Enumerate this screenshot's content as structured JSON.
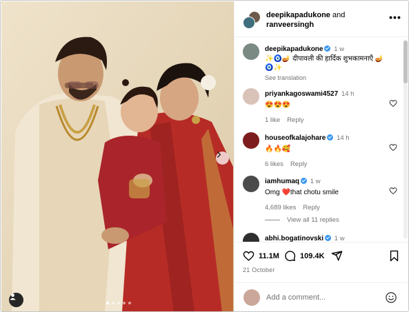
{
  "header": {
    "user1": "deepikapadukone",
    "joiner": "and",
    "user2": "ranveersingh",
    "more_label": "•••"
  },
  "caption": {
    "username": "deepikapadukone",
    "time": "1 w",
    "text": "✨🧿🪔 दीपावली की हार्दिक शुभकामनाएँ 🪔 🧿✨",
    "see_translation": "See translation"
  },
  "comments": [
    {
      "username": "priyankagoswami4527",
      "verified": false,
      "time": "14 h",
      "text": "😍😍😍",
      "likes": "1 like",
      "reply": "Reply"
    },
    {
      "username": "houseofkalajohare",
      "verified": true,
      "time": "14 h",
      "text": "🔥🔥🥰",
      "likes": "6 likes",
      "reply": "Reply"
    },
    {
      "username": "iamhumaq",
      "verified": true,
      "time": "1 w",
      "text": "Omg ❤️that chotu smile",
      "likes": "4,689 likes",
      "reply": "Reply"
    },
    {
      "username": "abhi.bogatinovski",
      "verified": true,
      "time": "1 w",
      "text": "",
      "likes": "",
      "reply": ""
    }
  ],
  "view_replies": "View all 11 replies",
  "actions": {
    "likes": "11.1M",
    "comments": "109.4K",
    "date": "21 October"
  },
  "composer": {
    "placeholder": "Add a comment..."
  },
  "carousel": {
    "total": 5,
    "active": 0
  },
  "colors": {
    "verified": "#3897f0",
    "meta_gray": "#737373",
    "border": "#efefef"
  },
  "icons": [
    "heart-icon",
    "comment-icon",
    "share-icon",
    "bookmark-icon",
    "emoji-icon",
    "chevron-right-icon",
    "user-tag-icon",
    "more-icon"
  ]
}
